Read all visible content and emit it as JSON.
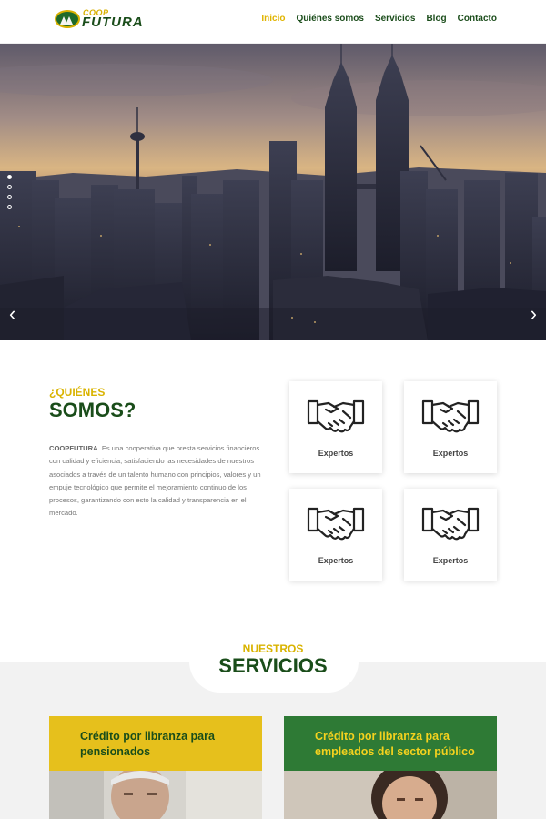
{
  "header": {
    "logo": {
      "top_text": "COOP",
      "main_text": "FUTURA"
    },
    "nav": [
      "Inicio",
      "Quiénes somos",
      "Servicios",
      "Blog",
      "Contacto"
    ],
    "active_nav": "Inicio"
  },
  "hero": {
    "slide_count": 4,
    "active_slide": 1,
    "prev_icon": "chevron-left-icon",
    "next_icon": "chevron-right-icon"
  },
  "about": {
    "kicker": "¿QUIÉNES",
    "title": "SOMOS?",
    "brand": "COOPFUTURA",
    "text": "Es una cooperativa que  presta servicios financieros con calidad y eficiencia, satisfaciendo las necesidades de nuestros asociados a través de un talento humano con principios, valores y un empuje tecnológico que permite el mejoramiento continuo de los procesos, garantizando con esto la calidad y  transparencia en el mercado.",
    "cards": [
      {
        "icon": "handshake-icon",
        "label": "Expertos"
      },
      {
        "icon": "handshake-icon",
        "label": "Expertos"
      },
      {
        "icon": "handshake-icon",
        "label": "Expertos"
      },
      {
        "icon": "handshake-icon",
        "label": "Expertos"
      }
    ]
  },
  "services": {
    "kicker": "NUESTROS",
    "title": "SERVICIOS",
    "cards": [
      {
        "title": "Crédito por libranza para pensionados",
        "color": "#e6c01c"
      },
      {
        "title": "Crédito por libranza para empleados del sector público",
        "color": "#2e7a35"
      }
    ]
  },
  "colors": {
    "brand_green": "#1a4d1a",
    "brand_yellow": "#d9b300"
  }
}
